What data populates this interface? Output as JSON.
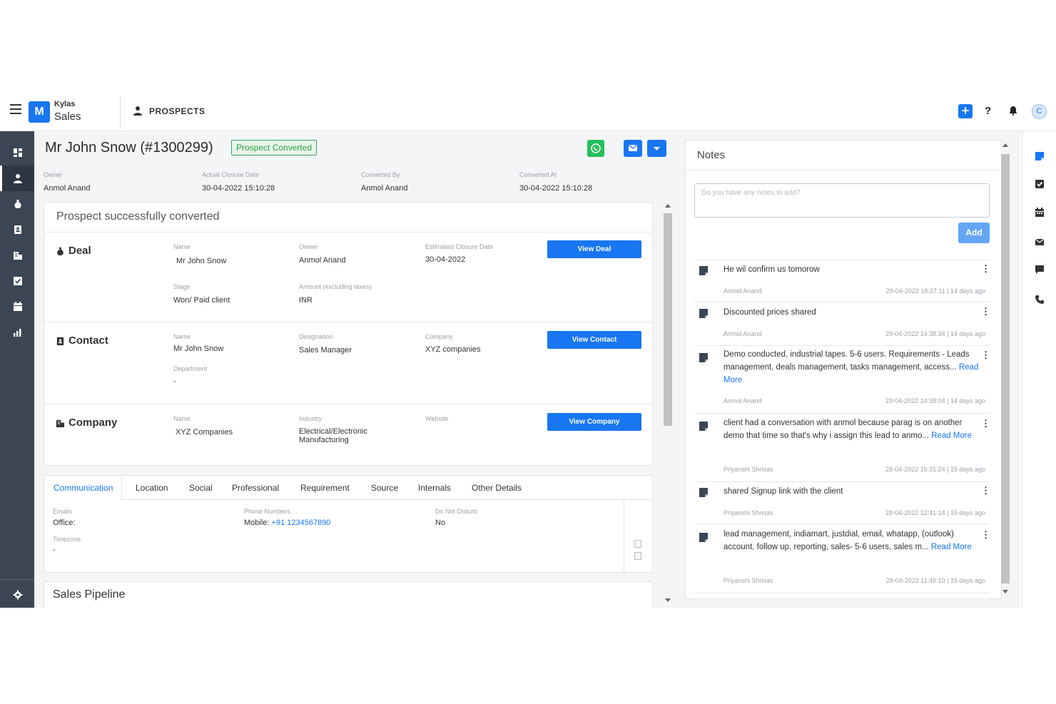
{
  "brand": {
    "top": "Kylas",
    "bottom": "Sales",
    "logo": "M"
  },
  "header": {
    "module": "PROSPECTS",
    "plus_label": "+",
    "help_label": "?",
    "avatar_initial": "C"
  },
  "record": {
    "title": "Mr John Snow (#1300299)",
    "status_badge": "Prospect Converted",
    "meta": [
      {
        "label": "Owner",
        "value": "Anmol Anand"
      },
      {
        "label": "Actual Closure Date",
        "value": "30-04-2022 15:10:28"
      },
      {
        "label": "Converted By",
        "value": "Anmol Anand"
      },
      {
        "label": "Converted At",
        "value": "30-04-2022 15:10:28"
      }
    ]
  },
  "conversion": {
    "heading": "Prospect successfully converted",
    "deal": {
      "title": "Deal",
      "button": "View Deal",
      "fields": [
        {
          "label": "Name",
          "value": "Mr John Snow"
        },
        {
          "label": "Owner",
          "value": "Anmol Anand"
        },
        {
          "label": "Estimated Closure Date",
          "value": "30-04-2022"
        },
        {
          "label": "Stage",
          "value": "Won/ Paid client"
        },
        {
          "label": "Amount (excluding taxes)",
          "value": "INR"
        }
      ]
    },
    "contact": {
      "title": "Contact",
      "button": "View Contact",
      "fields": [
        {
          "label": "Name",
          "value": "Mr John Snow"
        },
        {
          "label": "Designation",
          "value": "Sales Manager"
        },
        {
          "label": "Company",
          "value": "XYZ companies"
        },
        {
          "label": "Department",
          "value": "-"
        }
      ]
    },
    "company": {
      "title": "Company",
      "button": "View Company",
      "fields": [
        {
          "label": "Name",
          "value": "XYZ Companies"
        },
        {
          "label": "Industry",
          "value": "Electrical/Electronic Manufacturing"
        },
        {
          "label": "Website",
          "value": ""
        }
      ]
    }
  },
  "details": {
    "tabs": [
      "Communication",
      "Location",
      "Social",
      "Professional",
      "Requirement",
      "Source",
      "Internals",
      "Other Details"
    ],
    "emails_label": "Emails",
    "office_label": "Office:",
    "phones_label": "Phone Numbers",
    "mobile_label": "Mobile:",
    "mobile_value": "+91 1234567890",
    "dnd_label": "Do Not Disturb",
    "dnd_value": "No",
    "timezone_label": "Timezone",
    "timezone_value": "-"
  },
  "pipeline": {
    "title": "Sales Pipeline"
  },
  "notes": {
    "title": "Notes",
    "placeholder": "Do you have any notes to add?",
    "add_label": "Add",
    "more_label": "⋮",
    "read_more": "Read More",
    "items": [
      {
        "text": "He wil confirm us tomorow",
        "author": "Anmol Anand",
        "date": "29-04-2022 18:27:11  |  14 days ago"
      },
      {
        "text": "Discounted prices shared",
        "author": "Anmol Anand",
        "date": "29-04-2022 14:38:34  |  14 days ago"
      },
      {
        "text": "Demo conducted, industrial tapes. 5-6 users. Requirements - Leads management, deals management, tasks management, access...",
        "author": "Anmol Anand",
        "date": "29-04-2022 14:38:04  |  14 days ago",
        "has_more": true
      },
      {
        "text": "client had a conversation with anmol because parag is on another demo that time so that's why i assign this lead to anmo...",
        "author": "Priyanshi Shrivas",
        "date": "28-04-2022 16:31:24  |  15 days ago",
        "has_more": true
      },
      {
        "text": "shared Signup link with the client",
        "author": "Priyanshi Shrivas",
        "date": "28-04-2022 12:41:14  |  15 days ago"
      },
      {
        "text": "lead management, indiamart, justdial, email, whatapp, (outlook) account, follow up, reporting, sales- 5-6 users, sales m...",
        "author": "Priyanshi Shrivas",
        "date": "28-04-2022 11:40:10  |  15 days ago",
        "has_more": true
      }
    ]
  },
  "colors": {
    "primary": "#1976f2",
    "sidebar": "#3b4553",
    "success": "#2f9e44",
    "whatsapp": "#25c05a"
  }
}
